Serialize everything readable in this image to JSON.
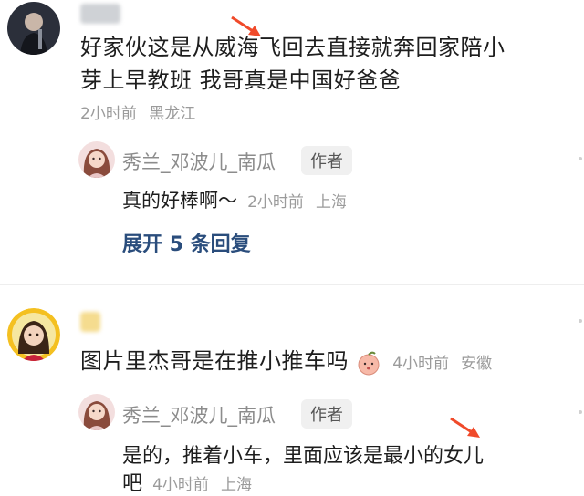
{
  "comments": [
    {
      "text_line1": "好家伙这是从威海飞回去直接就奔回家陪小",
      "text_line2": "芽上早教班 我哥真是中国好爸爸",
      "time": "2小时前",
      "location": "黑龙江",
      "reply": {
        "author": "秀兰_邓波儿_南瓜",
        "badge": "作者",
        "text": "真的好棒啊～",
        "time": "2小时前",
        "location": "上海"
      },
      "expand_label": "展开 5 条回复"
    },
    {
      "text": "图片里杰哥是在推小推车吗",
      "time": "4小时前",
      "location": "安徽",
      "reply": {
        "author": "秀兰_邓波儿_南瓜",
        "badge": "作者",
        "text_line1": "是的，推着小车，里面应该是最小的女儿",
        "text_line2": "吧",
        "time": "4小时前",
        "location": "上海"
      }
    }
  ],
  "colors": {
    "arrow": "#f04a2a",
    "expand_link": "#2a4d7c",
    "meta_gray": "#9b9b9b"
  },
  "icons": [
    "user-avatar-icon",
    "author-avatar-icon",
    "peach-emoji-icon",
    "red-arrow-icon"
  ]
}
